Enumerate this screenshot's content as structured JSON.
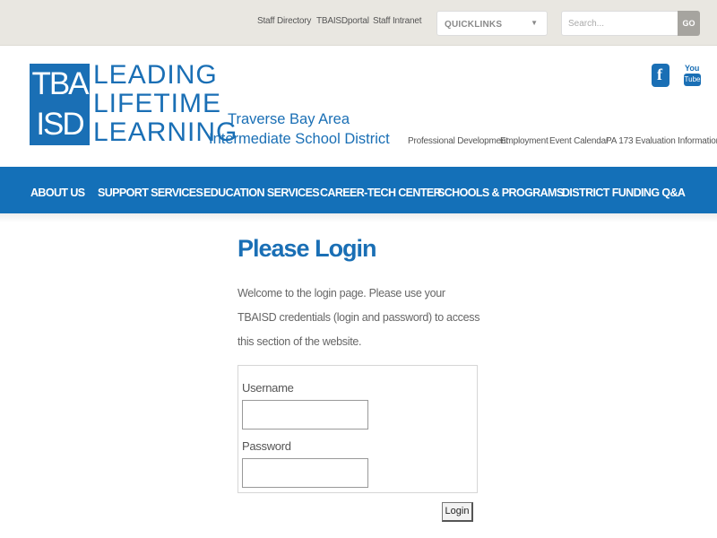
{
  "top_bar": {
    "links": [
      "Staff Directory",
      "TBAISDportal",
      "Staff Intranet"
    ],
    "quicklinks_label": "QUICKLINKS",
    "search_placeholder": "Search...",
    "search_button": "GO"
  },
  "logo": {
    "box_lines": [
      "TBA",
      "ISD"
    ],
    "words": [
      "LEADING",
      "LIFETIME",
      "LEARNING"
    ],
    "district_lines": [
      "Traverse Bay Area",
      "Intermediate School District"
    ],
    "brand_color": "#1a6fb5"
  },
  "social": {
    "facebook_glyph": "f",
    "youtube_top": "You",
    "youtube_bottom": "Tube"
  },
  "secondary_nav": [
    "Professional Development",
    "Employment",
    "Event Calendar",
    "PA 173 Evaluation Information"
  ],
  "main_nav": [
    "ABOUT US",
    "SUPPORT SERVICES",
    "EDUCATION SERVICES",
    "CAREER-TECH CENTER",
    "SCHOOLS & PROGRAMS",
    "DISTRICT FUNDING Q&A"
  ],
  "login": {
    "title": "Please Login",
    "intro": "Welcome to the login page. Please use your TBAISD credentials (login and password) to access this section of the website.",
    "username_label": "Username",
    "username_value": "",
    "password_label": "Password",
    "password_value": "",
    "button_label": "Login"
  }
}
